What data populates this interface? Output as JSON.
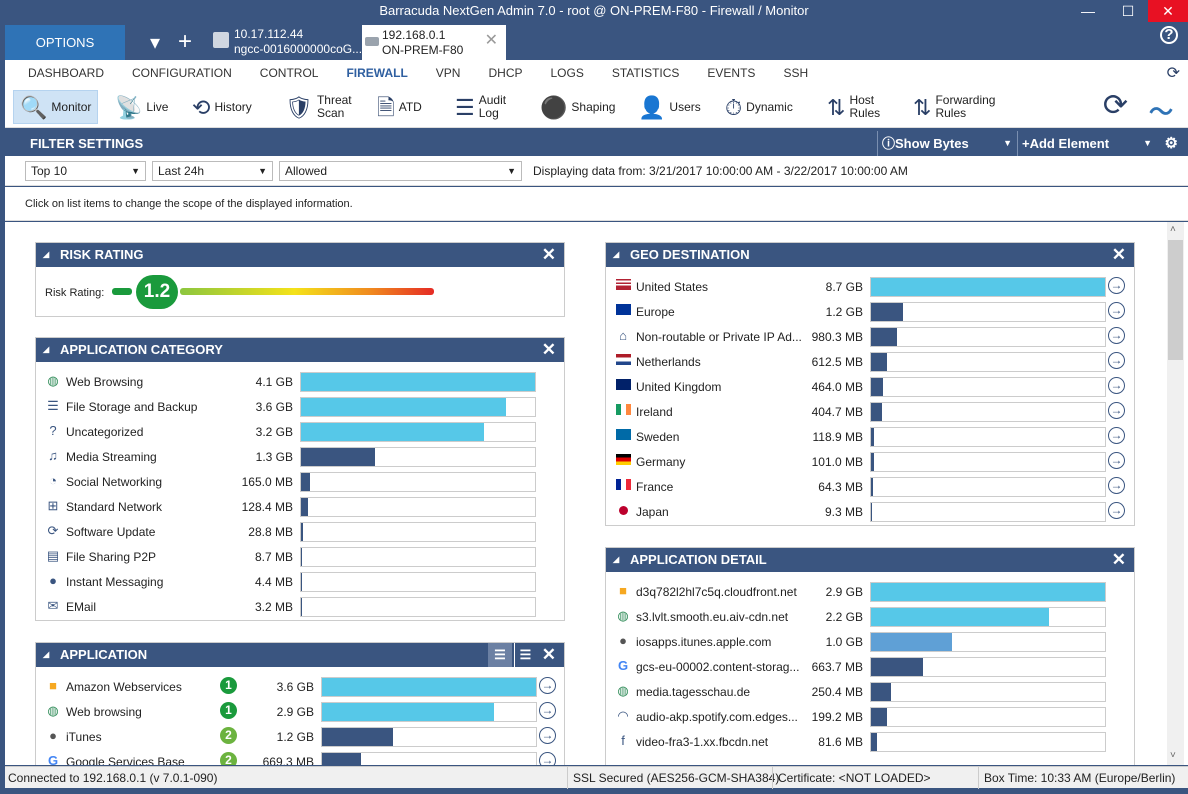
{
  "window": {
    "title": "Barracuda NextGen Admin 7.0 -  root @ ON-PREM-F80 - Firewall / Monitor",
    "minimize": "—",
    "maximize": "☐",
    "close": "✕"
  },
  "tabs": {
    "options": "OPTIONS",
    "tab1_line1": "10.17.112.44",
    "tab1_line2": "ngcc-0016000000coG...",
    "tab2_line1": "192.168.0.1",
    "tab2_line2": "ON-PREM-F80",
    "help": "?"
  },
  "nav": [
    "DASHBOARD",
    "CONFIGURATION",
    "CONTROL",
    "FIREWALL",
    "VPN",
    "DHCP",
    "LOGS",
    "STATISTICS",
    "EVENTS",
    "SSH"
  ],
  "nav_active": "FIREWALL",
  "toolbar": [
    {
      "label": "Monitor",
      "icon": "magnifier-icon",
      "glyph": "🔍"
    },
    {
      "label": "Live",
      "icon": "antenna-icon",
      "glyph": "📡"
    },
    {
      "label": "History",
      "icon": "history-icon",
      "glyph": "⟲"
    },
    {
      "label": "Threat\nScan",
      "icon": "shield-scan-icon",
      "glyph": "🛡"
    },
    {
      "label": "ATD",
      "icon": "document-scan-icon",
      "glyph": "🗎"
    },
    {
      "label": "Audit\nLog",
      "icon": "log-icon",
      "glyph": "☰"
    },
    {
      "label": "Shaping",
      "icon": "traffic-light-icon",
      "glyph": "⚫"
    },
    {
      "label": "Users",
      "icon": "user-icon",
      "glyph": "👤"
    },
    {
      "label": "Dynamic",
      "icon": "stopwatch-icon",
      "glyph": "⏱"
    },
    {
      "label": "Host\nRules",
      "icon": "host-rules-icon",
      "glyph": "⇅"
    },
    {
      "label": "Forwarding\nRules",
      "icon": "forwarding-rules-icon",
      "glyph": "⇅"
    }
  ],
  "filter": {
    "title": "FILTER SETTINGS",
    "show_bytes": "Show Bytes",
    "add_element": "Add Element",
    "top": "Top 10",
    "range": "Last 24h",
    "policy": "Allowed",
    "displaying": "Displaying data from: 3/21/2017 10:00:00 AM - 3/22/2017 10:00:00 AM",
    "hint": "Click on list items to change the scope of the displayed information."
  },
  "colors": {
    "header": "#3a5580",
    "bar_high": "#56c8e8",
    "bar_mid": "#5fa0d6",
    "bar_low": "#3a5580",
    "badge1": "#1a9a3c",
    "badge2": "#6cb33f"
  },
  "risk": {
    "title": "RISK RATING",
    "label": "Risk Rating:",
    "value": "1.2"
  },
  "app_category": {
    "title": "APPLICATION CATEGORY",
    "rows": [
      {
        "name": "Web Browsing",
        "value": "4.1 GB",
        "icon": "globe-icon",
        "glyph": "◍",
        "color": "high"
      },
      {
        "name": "File Storage and Backup",
        "value": "3.6 GB",
        "icon": "database-icon",
        "glyph": "☰",
        "color": "high"
      },
      {
        "name": "Uncategorized",
        "value": "3.2 GB",
        "icon": "question-icon",
        "glyph": "?",
        "color": "high"
      },
      {
        "name": "Media Streaming",
        "value": "1.3 GB",
        "icon": "music-icon",
        "glyph": "♫",
        "color": "low"
      },
      {
        "name": "Social Networking",
        "value": "165.0 MB",
        "icon": "social-icon",
        "glyph": "◔",
        "color": "low"
      },
      {
        "name": "Standard Network",
        "value": "128.4 MB",
        "icon": "network-icon",
        "glyph": "⊞",
        "color": "low"
      },
      {
        "name": "Software Update",
        "value": "28.8 MB",
        "icon": "refresh-icon",
        "glyph": "⟳",
        "color": "low"
      },
      {
        "name": "File Sharing P2P",
        "value": "8.7 MB",
        "icon": "file-share-icon",
        "glyph": "▤",
        "color": "low"
      },
      {
        "name": "Instant Messaging",
        "value": "4.4 MB",
        "icon": "chat-icon",
        "glyph": "●",
        "color": "low"
      },
      {
        "name": "EMail",
        "value": "3.2 MB",
        "icon": "mail-icon",
        "glyph": "✉",
        "color": "low"
      }
    ]
  },
  "application": {
    "title": "APPLICATION",
    "rows": [
      {
        "name": "Amazon Webservices",
        "risk": "1",
        "value": "3.6 GB",
        "icon": "amazon-box-icon",
        "glyph": "■",
        "color": "high"
      },
      {
        "name": "Web browsing",
        "risk": "1",
        "value": "2.9 GB",
        "icon": "globe-icon",
        "glyph": "◍",
        "color": "high"
      },
      {
        "name": "iTunes",
        "risk": "2",
        "value": "1.2 GB",
        "icon": "apple-icon",
        "glyph": "●",
        "color": "low"
      },
      {
        "name": "Google Services Base",
        "risk": "2",
        "value": "669.3 MB",
        "icon": "google-icon",
        "glyph": "G",
        "color": "low"
      }
    ]
  },
  "geo": {
    "title": "GEO DESTINATION",
    "rows": [
      {
        "name": "United States",
        "value": "8.7 GB",
        "icon": "flag-us-icon",
        "color": "high"
      },
      {
        "name": "Europe",
        "value": "1.2 GB",
        "icon": "flag-eu-icon",
        "color": "low"
      },
      {
        "name": "Non-routable or Private IP Ad...",
        "value": "980.3 MB",
        "icon": "home-icon",
        "color": "low"
      },
      {
        "name": "Netherlands",
        "value": "612.5 MB",
        "icon": "flag-nl-icon",
        "color": "low"
      },
      {
        "name": "United Kingdom",
        "value": "464.0 MB",
        "icon": "flag-uk-icon",
        "color": "low"
      },
      {
        "name": "Ireland",
        "value": "404.7 MB",
        "icon": "flag-ie-icon",
        "color": "low"
      },
      {
        "name": "Sweden",
        "value": "118.9 MB",
        "icon": "flag-se-icon",
        "color": "low"
      },
      {
        "name": "Germany",
        "value": "101.0 MB",
        "icon": "flag-de-icon",
        "color": "low"
      },
      {
        "name": "France",
        "value": "64.3 MB",
        "icon": "flag-fr-icon",
        "color": "low"
      },
      {
        "name": "Japan",
        "value": "9.3 MB",
        "icon": "flag-jp-icon",
        "color": "low"
      }
    ]
  },
  "app_detail": {
    "title": "APPLICATION DETAIL",
    "rows": [
      {
        "name": "d3q782l2hl7c5q.cloudfront.net",
        "value": "2.9 GB",
        "icon": "amazon-box-icon",
        "glyph": "■",
        "color": "high"
      },
      {
        "name": "s3.lvlt.smooth.eu.aiv-cdn.net",
        "value": "2.2 GB",
        "icon": "globe-icon",
        "glyph": "◍",
        "color": "high"
      },
      {
        "name": "iosapps.itunes.apple.com",
        "value": "1.0 GB",
        "icon": "apple-icon",
        "glyph": "●",
        "color": "mid"
      },
      {
        "name": "gcs-eu-00002.content-storag...",
        "value": "663.7 MB",
        "icon": "google-icon",
        "glyph": "G",
        "color": "low"
      },
      {
        "name": "media.tagesschau.de",
        "value": "250.4 MB",
        "icon": "globe-icon",
        "glyph": "◍",
        "color": "low"
      },
      {
        "name": "audio-akp.spotify.com.edges...",
        "value": "199.2 MB",
        "icon": "spotify-icon",
        "glyph": "◠",
        "color": "low"
      },
      {
        "name": "video-fra3-1.xx.fbcdn.net",
        "value": "81.6 MB",
        "icon": "facebook-icon",
        "glyph": "f",
        "color": "low"
      }
    ]
  },
  "status": {
    "connected": "Connected to 192.168.0.1 (v 7.0.1-090)",
    "ssl": "SSL Secured (AES256-GCM-SHA384)",
    "cert": "Certificate: <NOT LOADED>",
    "time": "Box Time: 10:33 AM (Europe/Berlin)"
  }
}
